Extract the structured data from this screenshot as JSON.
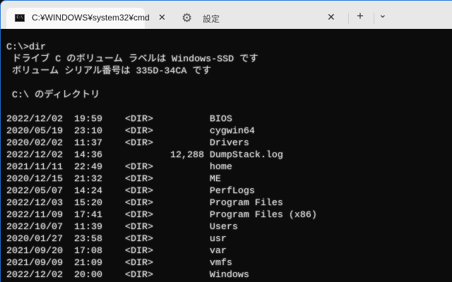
{
  "tabs": [
    {
      "title": "C:¥WINDOWS¥system32¥cmd",
      "icon": "cmd-icon",
      "active": true
    },
    {
      "title": "設定",
      "icon": "gear-icon",
      "active": false
    }
  ],
  "controls": {
    "close": "✕",
    "new_tab": "+",
    "dropdown": "⌄"
  },
  "terminal": {
    "lines": [
      "C:\\>dir",
      " ドライブ C のボリューム ラベルは Windows-SSD です",
      " ボリューム シリアル番号は 335D-34CA です",
      "",
      " C:\\ のディレクトリ",
      "",
      "2022/12/02  19:59    <DIR>          BIOS",
      "2020/05/19  23:10    <DIR>          cygwin64",
      "2020/02/02  11:37    <DIR>          Drivers",
      "2022/12/02  14:36            12,288 DumpStack.log",
      "2021/11/11  22:49    <DIR>          home",
      "2020/12/15  21:32    <DIR>          ME",
      "2022/05/07  14:24    <DIR>          PerfLogs",
      "2022/12/03  15:20    <DIR>          Program Files",
      "2022/11/09  17:41    <DIR>          Program Files (x86)",
      "2022/10/07  11:39    <DIR>          Users",
      "2020/01/27  23:58    <DIR>          usr",
      "2021/09/20  17:08    <DIR>          var",
      "2021/09/09  21:09    <DIR>          vmfs",
      "2022/12/02  20:00    <DIR>          Windows"
    ]
  },
  "colors": {
    "terminal_bg": "#0c0c0c",
    "text": "#d8d8d8",
    "accent": "#1a73d9"
  }
}
